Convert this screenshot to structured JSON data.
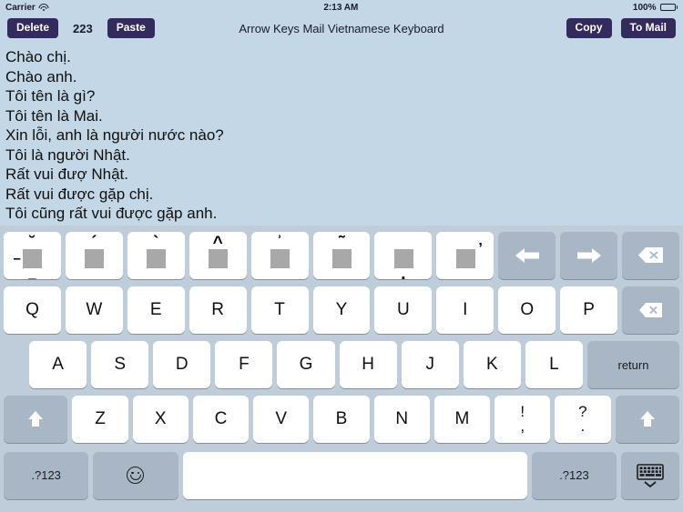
{
  "status_bar": {
    "carrier": "Carrier",
    "wifi_icon": "wifi-icon",
    "time": "2:13 AM",
    "battery_percent": "100%",
    "battery_icon": "battery-full-icon"
  },
  "toolbar": {
    "delete_label": "Delete",
    "character_count": "223",
    "paste_label": "Paste",
    "title": "Arrow Keys Mail Vietnamese Keyboard",
    "copy_label": "Copy",
    "to_mail_label": "To Mail"
  },
  "text_area": {
    "lines": [
      "Chào chị.",
      "Chào anh.",
      "Tôi tên là gì?",
      "Tôi tên là Mai.",
      "Xin lỗi, anh là người nước nào?",
      "Tôi là người Nhật.",
      "Rất vui đượ Nhật.",
      "Rất vui được gặp chị.",
      "Tôi cũng rất vui được gặp anh."
    ]
  },
  "keyboard": {
    "diacritic_row": [
      {
        "name": "key-breve-bar-combo",
        "above": "˘",
        "left": "–",
        "below": "_"
      },
      {
        "name": "key-acute",
        "above": "´"
      },
      {
        "name": "key-grave",
        "above": "`"
      },
      {
        "name": "key-circumflex",
        "above": "^"
      },
      {
        "name": "key-hook-above",
        "above": "ʾ"
      },
      {
        "name": "key-tilde",
        "above": "˜"
      },
      {
        "name": "key-dot-below",
        "below_dot": "."
      },
      {
        "name": "key-horn",
        "horn": "ʼ"
      }
    ],
    "nav_keys": [
      {
        "name": "arrow-left-key",
        "icon": "arrow-left-icon"
      },
      {
        "name": "arrow-right-key",
        "icon": "arrow-right-icon"
      },
      {
        "name": "clear-key",
        "icon": "delete-tag-icon"
      }
    ],
    "row_q": [
      "Q",
      "W",
      "E",
      "R",
      "T",
      "Y",
      "U",
      "I",
      "O",
      "P"
    ],
    "backspace_icon": "backspace-icon",
    "row_a": [
      "A",
      "S",
      "D",
      "F",
      "G",
      "H",
      "J",
      "K",
      "L"
    ],
    "return_label": "return",
    "row_z": [
      "Z",
      "X",
      "C",
      "V",
      "B",
      "N",
      "M"
    ],
    "punct_keys": [
      {
        "name": "key-exclam-comma",
        "top": "!",
        "bottom": ","
      },
      {
        "name": "key-question-period",
        "top": "?",
        "bottom": "."
      }
    ],
    "shift_left_icon": "shift-icon",
    "shift_right_icon": "shift-icon",
    "bottom_row": {
      "numeric_left_label": ".?123",
      "emoji_icon": "emoji-smiley-icon",
      "space_label": "",
      "numeric_right_label": ".?123",
      "hide_keyboard_icon": "hide-keyboard-icon"
    }
  },
  "colors": {
    "background": "#c3d7e6",
    "toolbar_button": "#332a5e",
    "keyboard_background": "#bfcddb",
    "key_light": "#ffffff",
    "key_dark": "#a8b6c6"
  }
}
